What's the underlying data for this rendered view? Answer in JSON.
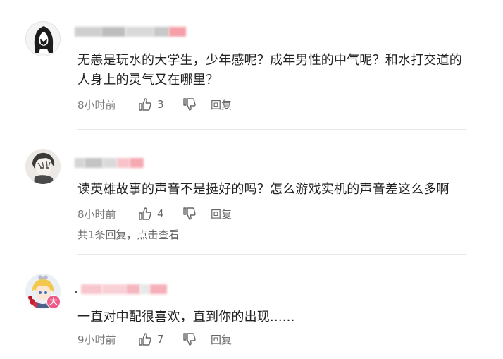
{
  "comments": [
    {
      "avatar": "hooded-figure-avatar",
      "text": "无恙是玩水的大学生，少年感呢？成年男性的中气呢？和水打交道的人身上的灵气又在哪里？",
      "time": "8小时前",
      "likes": "3",
      "reply_label": "回复"
    },
    {
      "avatar": "anime-character-avatar",
      "text": "读英雄故事的声音不是挺好的吗？怎么游戏实机的声音差这么多啊",
      "time": "8小时前",
      "likes": "4",
      "reply_label": "回复",
      "more_replies": "共1条回复，点击查看"
    },
    {
      "avatar": "blonde-character-avatar",
      "badge": "大",
      "text": "一直对中配很喜欢，直到你的出现......",
      "time": "9小时前",
      "likes": "7",
      "reply_label": "回复"
    }
  ],
  "colors": {
    "text": "#222222",
    "meta": "#666666",
    "divider": "#e6e6e6",
    "badge": "#ee5a8a"
  },
  "icons": {
    "like": "thumbs-up-icon",
    "dislike": "thumbs-down-icon"
  }
}
